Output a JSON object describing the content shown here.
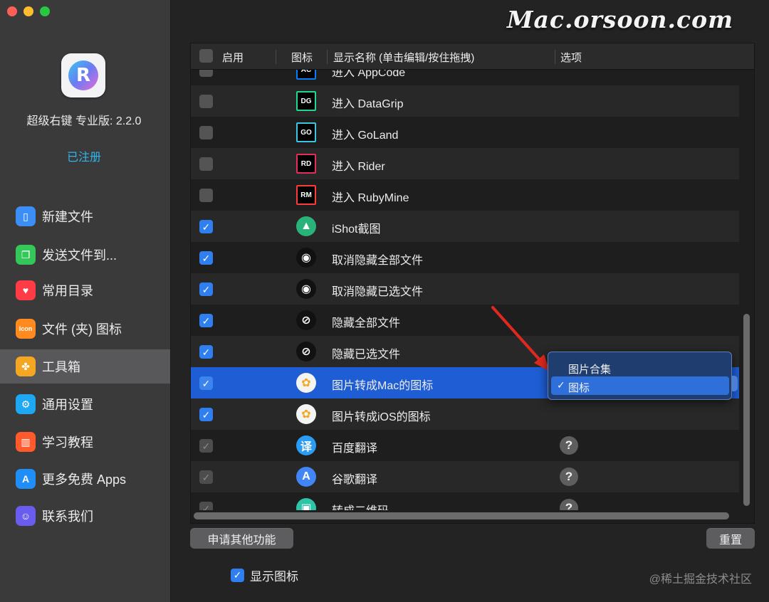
{
  "app": {
    "name_version": "超级右键 专业版: 2.2.0",
    "status": "已注册"
  },
  "sidebar": {
    "items": [
      {
        "label": "新建文件",
        "icon": "document-icon",
        "color": "#3a8ef6",
        "glyph": "▯"
      },
      {
        "label": "发送文件到...",
        "icon": "copy-icon",
        "color": "#34c759",
        "glyph": "❐"
      },
      {
        "label": "常用目录",
        "icon": "heart-icon",
        "color": "#ff3b46",
        "glyph": "♥"
      },
      {
        "label": "文件 (夹) 图标",
        "icon": "icon-badge-icon",
        "color": "#ff8a1f",
        "glyph": "Icon"
      },
      {
        "label": "工具箱",
        "icon": "toolbox-icon",
        "color": "#f5a623",
        "glyph": "✤"
      },
      {
        "label": "通用设置",
        "icon": "gear-icon",
        "color": "#1fa8f2",
        "glyph": "⚙"
      },
      {
        "label": "学习教程",
        "icon": "book-icon",
        "color": "#ff5a2c",
        "glyph": "▥"
      },
      {
        "label": "更多免费 Apps",
        "icon": "app-store-icon",
        "color": "#1f8ef6",
        "glyph": "A"
      },
      {
        "label": "联系我们",
        "icon": "people-icon",
        "color": "#6b5cf0",
        "glyph": "☺"
      }
    ],
    "active_index": 4
  },
  "watermark": "Mac.orsoon.com",
  "table": {
    "headers": {
      "enabled": "启用",
      "icon": "图标",
      "name": "显示名称 (单击编辑/按住拖拽)",
      "options": "选项"
    },
    "rows": [
      {
        "name": "进入 AppCode",
        "checked": false,
        "icon": "appcode-icon",
        "badge": "AC",
        "icon_color": "#087cfa",
        "option": ""
      },
      {
        "name": "进入 DataGrip",
        "checked": false,
        "icon": "datagrip-icon",
        "badge": "DG",
        "icon_color": "#22d88f",
        "option": ""
      },
      {
        "name": "进入 GoLand",
        "checked": false,
        "icon": "goland-icon",
        "badge": "GO",
        "icon_color": "#3bc5e4",
        "option": ""
      },
      {
        "name": "进入 Rider",
        "checked": false,
        "icon": "rider-icon",
        "badge": "RD",
        "icon_color": "#e62d59",
        "option": ""
      },
      {
        "name": "进入 RubyMine",
        "checked": false,
        "icon": "rubymine-icon",
        "badge": "RM",
        "icon_color": "#fc3a3a",
        "option": ""
      },
      {
        "name": "iShot截图",
        "checked": true,
        "icon": "ishot-icon",
        "badge": "▲",
        "icon_color": "#29b37a",
        "option": ""
      },
      {
        "name": "取消隐藏全部文件",
        "checked": true,
        "icon": "eye-icon",
        "badge": "◉",
        "icon_color": "#111111",
        "option": ""
      },
      {
        "name": "取消隐藏已选文件",
        "checked": true,
        "icon": "eye-icon",
        "badge": "◉",
        "icon_color": "#111111",
        "option": ""
      },
      {
        "name": "隐藏全部文件",
        "checked": true,
        "icon": "eye-slash-icon",
        "badge": "⊘",
        "icon_color": "#111111",
        "option": ""
      },
      {
        "name": "隐藏已选文件",
        "checked": true,
        "icon": "eye-slash-icon",
        "badge": "⊘",
        "icon_color": "#111111",
        "option": ""
      },
      {
        "name": "图片转成Mac的图标",
        "checked": true,
        "icon": "photos-icon",
        "badge": "✿",
        "icon_color": "#f4f4f4",
        "option": "",
        "selected": true
      },
      {
        "name": "图片转成iOS的图标",
        "checked": true,
        "icon": "photos-icon",
        "badge": "✿",
        "icon_color": "#f4f4f4",
        "option": ""
      },
      {
        "name": "百度翻译",
        "checked": true,
        "dim": true,
        "icon": "baidu-translate-icon",
        "badge": "译",
        "icon_color": "#2b9cf2",
        "option": "?"
      },
      {
        "name": "谷歌翻译",
        "checked": true,
        "dim": true,
        "icon": "google-translate-icon",
        "badge": "A",
        "icon_color": "#4285f4",
        "option": "?"
      },
      {
        "name": "转成二维码",
        "checked": true,
        "dim": true,
        "icon": "qrcode-icon",
        "badge": "▣",
        "icon_color": "#2ec4a6",
        "option": "?"
      }
    ]
  },
  "popup": {
    "options": [
      "图片合集",
      "图标"
    ],
    "selected": "图标",
    "check": "✓"
  },
  "buttons": {
    "request": "申请其他功能",
    "reset": "重置"
  },
  "show_icons": {
    "label": "显示图标",
    "checked": true
  },
  "credit": "@稀土掘金技术社区",
  "colors": {
    "accent": "#2f7ff1",
    "selection": "#1e5dd4",
    "sidebar_bg": "#3b3a3b",
    "content_bg": "#232323"
  }
}
